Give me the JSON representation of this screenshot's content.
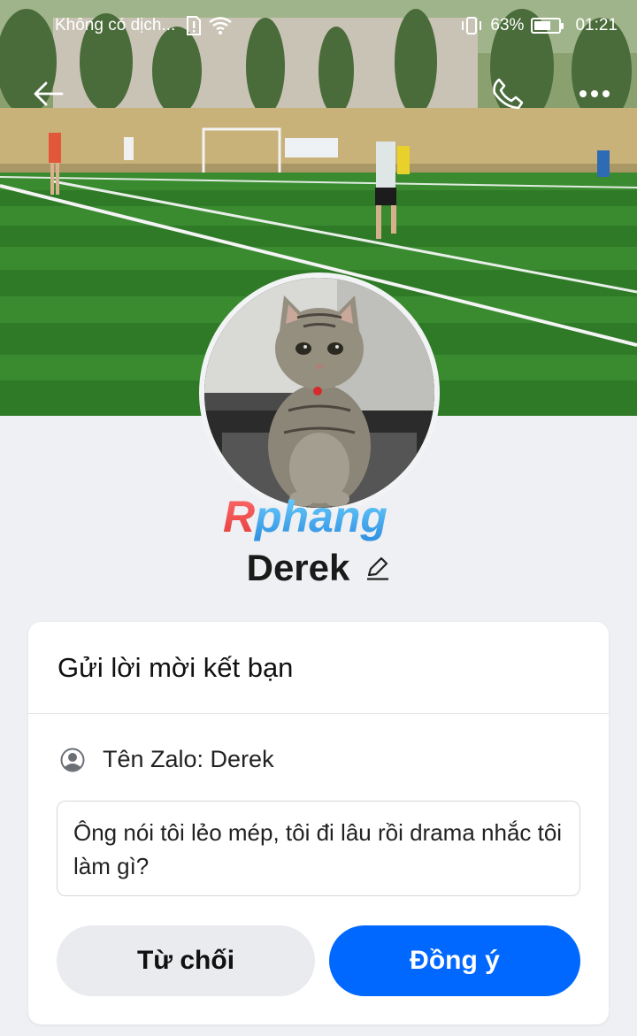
{
  "status_bar": {
    "carrier": "Không có dịch...",
    "battery": "63%",
    "time": "01:21"
  },
  "top_bar": {
    "icons": [
      "back-arrow-icon",
      "phone-icon",
      "more-icon"
    ]
  },
  "watermark": "Rphang",
  "profile": {
    "name": "Derek",
    "edit_icon": "pencil-icon"
  },
  "friend_request": {
    "title": "Gửi lời mời kết bạn",
    "zalo_name": "Tên Zalo: Derek",
    "message": "Ông nói tôi lẻo mép, tôi đi lâu rồi drama nhắc tôi làm gì?",
    "decline_label": "Từ chối",
    "accept_label": "Đồng ý"
  },
  "colors": {
    "accent": "#0068ff",
    "decline_bg": "#e9ebee",
    "page_bg": "#eef0f3"
  }
}
